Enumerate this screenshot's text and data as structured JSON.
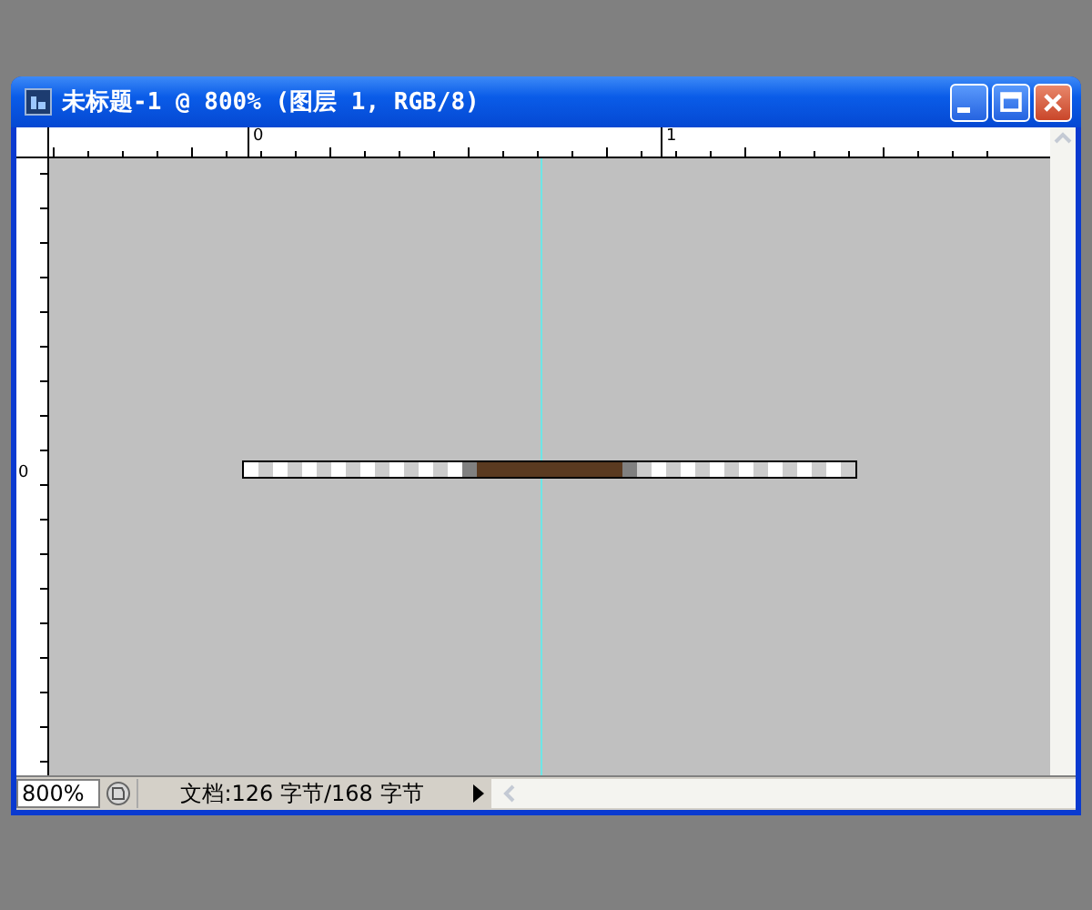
{
  "window": {
    "title": "未标题-1 @ 800% (图层 1, RGB/8)"
  },
  "rulers": {
    "horizontal_labels": [
      "0",
      "1"
    ],
    "vertical_labels": [
      "0"
    ]
  },
  "status_bar": {
    "zoom": "800%",
    "document_info": "文档:126 字节/168 字节"
  }
}
